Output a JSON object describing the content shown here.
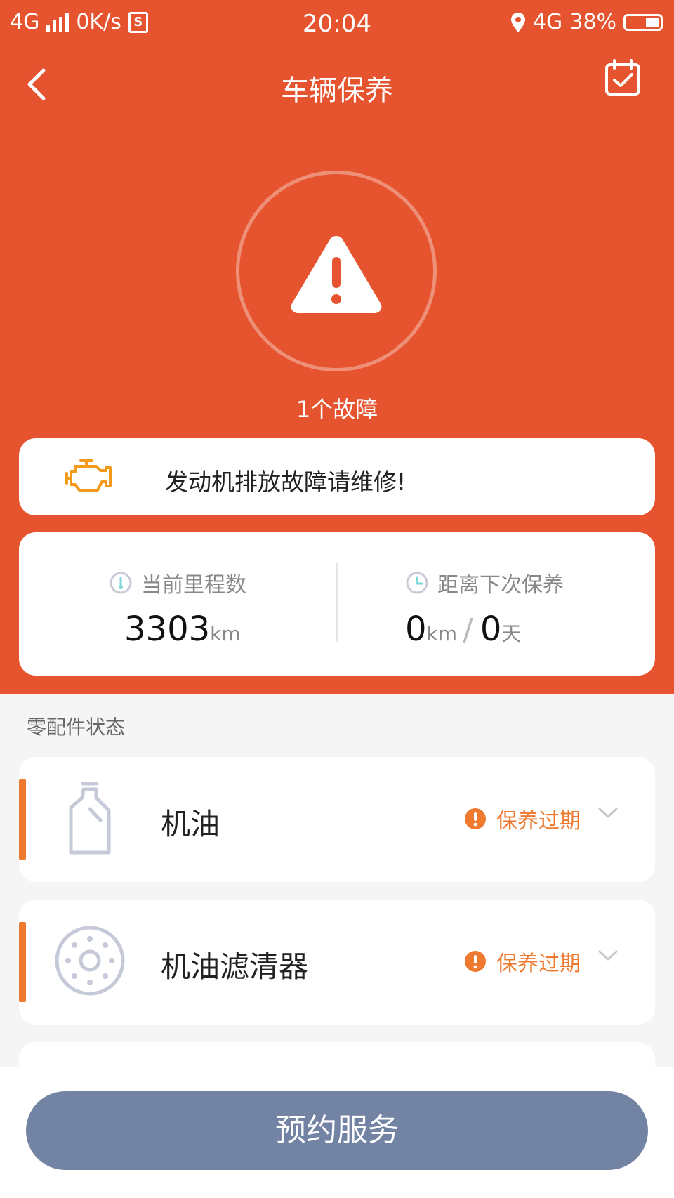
{
  "status_bar": {
    "network": "4G",
    "speed": "0K/s",
    "sim_label": "S",
    "time": "20:04",
    "network_right": "4G",
    "battery": "38%"
  },
  "nav": {
    "title": "车辆保养"
  },
  "summary": {
    "fault_count": "1个故障"
  },
  "fault": {
    "message": "发动机排放故障请维修!"
  },
  "mileage": {
    "current_label": "当前里程数",
    "current_value": "3303",
    "current_unit": "km",
    "next_label": "距离下次保养",
    "next_km": "0",
    "next_km_unit": "km",
    "separator": "/",
    "next_days": "0",
    "next_days_unit": "天"
  },
  "parts_section": {
    "title": "零配件状态",
    "items": [
      {
        "name": "机油",
        "status": "保养过期",
        "icon": "oil-bottle-icon"
      },
      {
        "name": "机油滤清器",
        "status": "保养过期",
        "icon": "oil-filter-icon"
      }
    ]
  },
  "cta": {
    "label": "预约服务"
  },
  "colors": {
    "primary": "#e5542f",
    "warning": "#ee7a30",
    "button": "#7283a3"
  }
}
